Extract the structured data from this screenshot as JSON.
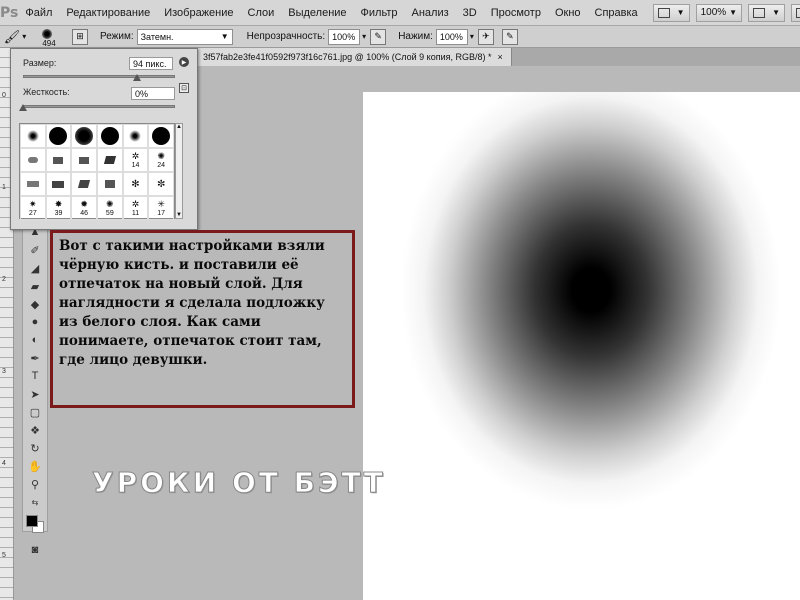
{
  "menubar": {
    "logo": "Ps",
    "items": [
      "Файл",
      "Редактирование",
      "Изображение",
      "Слои",
      "Выделение",
      "Фильтр",
      "Анализ",
      "3D",
      "Просмотр",
      "Окно",
      "Справка"
    ],
    "zoom": "100%"
  },
  "options": {
    "brush_size": "494",
    "mode_label": "Режим:",
    "mode_value": "Затемн.",
    "opacity_label": "Непрозрачность:",
    "opacity_value": "100%",
    "flow_label": "Нажим:",
    "flow_value": "100%"
  },
  "document": {
    "tab_title": "3f57fab2e3fe41f0592f973f16c761.jpg @ 100% (Слой 9 копия, RGB/8) *",
    "close": "×"
  },
  "brush_panel": {
    "size_label": "Размер:",
    "size_value": "94 пикс.",
    "size_fraction": 0.75,
    "hardness_label": "Жесткость:",
    "hardness_value": "0%",
    "hardness_fraction": 0.0,
    "row2_nums": [
      "14",
      "24"
    ],
    "row4_nums": [
      "27",
      "39",
      "46",
      "59",
      "11",
      "17"
    ]
  },
  "note": {
    "text": "Вот с такими настройками взяли чёрную кисть. и поставили её отпечаток на новый слой. Для наглядности я сделала подложку из белого слоя. Как сами понимаете, отпечаток стоит там, где лицо девушки."
  },
  "watermark": "УРОКИ ОТ БЭТТ",
  "ruler": [
    "0",
    "1",
    "2",
    "3",
    "4",
    "5"
  ],
  "colors": {
    "note_border": "#7b1a1a",
    "foreground": "#000000",
    "background": "#ffffff"
  }
}
